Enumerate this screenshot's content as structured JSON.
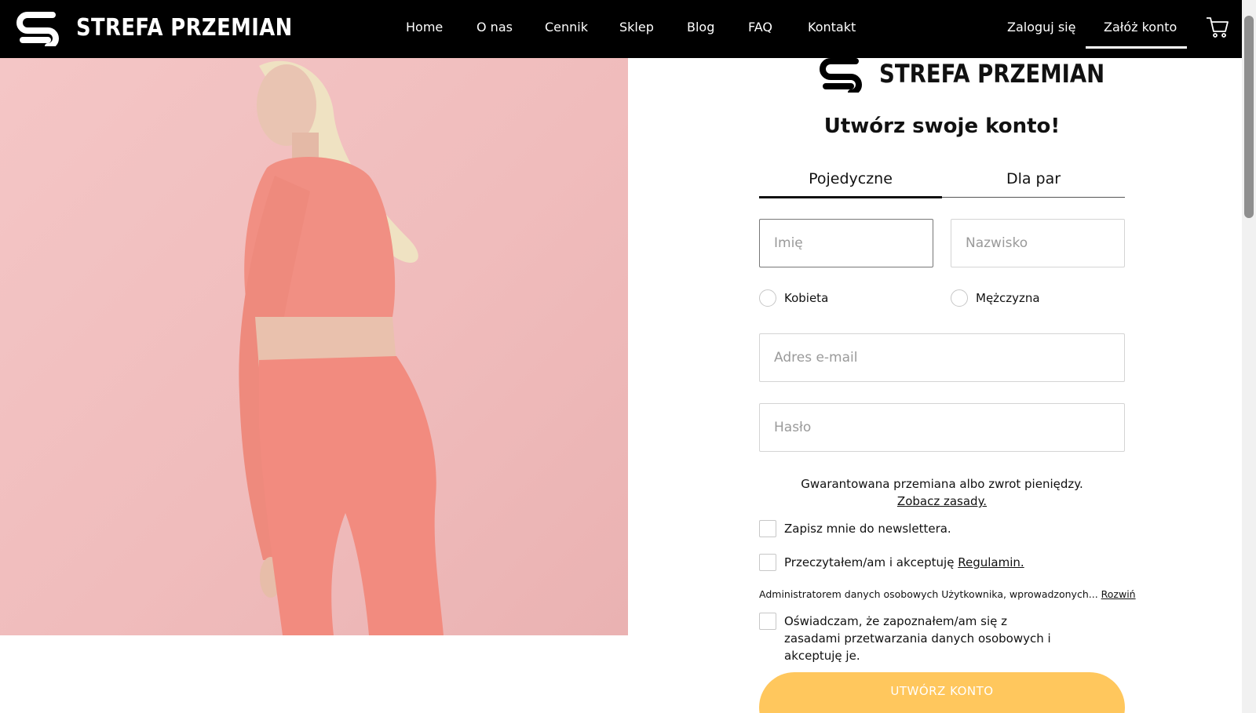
{
  "header": {
    "brand": "STREFA PRZEMIAN",
    "nav": [
      "Home",
      "O nas",
      "Cennik",
      "Sklep",
      "Blog",
      "FAQ",
      "Kontakt"
    ],
    "login": "Zaloguj się",
    "register": "Załóż konto",
    "cart_icon": "cart-icon"
  },
  "form": {
    "brand": "STREFA PRZEMIAN",
    "heading": "Utwórz swoje konto!",
    "tabs": [
      "Pojedyczne",
      "Dla par"
    ],
    "active_tab": "Pojedyczne",
    "first_name_placeholder": "Imię",
    "last_name_placeholder": "Nazwisko",
    "gender_female": "Kobieta",
    "gender_male": "Mężczyzna",
    "email_placeholder": "Adres e-mail",
    "password_placeholder": "Hasło",
    "guarantee_text": "Gwarantowana przemiana albo zwrot pieniędzy.",
    "guarantee_link": "Zobacz zasady.",
    "newsletter_label": "Zapisz mnie do newslettera.",
    "terms_label": "Przeczytałem/am i akceptuję",
    "terms_link": "Regulamin.",
    "admin_note": "Administratorem danych osobowych Użytkownika, wprowadzonych...",
    "admin_expand": "Rozwiń",
    "privacy_label": "Oświadczam, że zapoznałem/am się z zasadami przetwarzania danych osobowych i akceptuję je.",
    "submit": "UTWÓRZ KONTO"
  },
  "colors": {
    "navbar": "#000000",
    "submit_button": "#ffc75d",
    "hero_background": "#f4c6c6",
    "outfit": "#f08a7e"
  }
}
